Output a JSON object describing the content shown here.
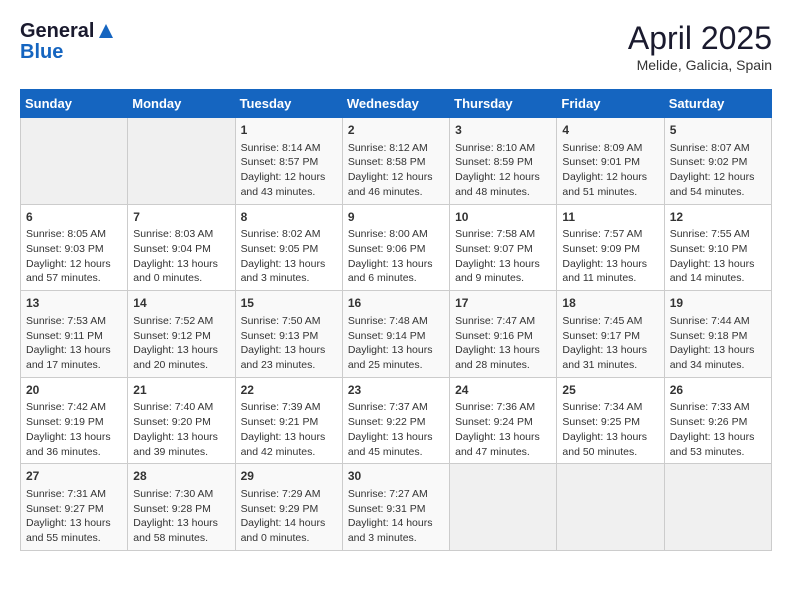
{
  "header": {
    "logo_general": "General",
    "logo_blue": "Blue",
    "title": "April 2025",
    "location": "Melide, Galicia, Spain"
  },
  "days_of_week": [
    "Sunday",
    "Monday",
    "Tuesday",
    "Wednesday",
    "Thursday",
    "Friday",
    "Saturday"
  ],
  "weeks": [
    [
      {
        "day": "",
        "content": ""
      },
      {
        "day": "",
        "content": ""
      },
      {
        "day": "1",
        "content": "Sunrise: 8:14 AM\nSunset: 8:57 PM\nDaylight: 12 hours and 43 minutes."
      },
      {
        "day": "2",
        "content": "Sunrise: 8:12 AM\nSunset: 8:58 PM\nDaylight: 12 hours and 46 minutes."
      },
      {
        "day": "3",
        "content": "Sunrise: 8:10 AM\nSunset: 8:59 PM\nDaylight: 12 hours and 48 minutes."
      },
      {
        "day": "4",
        "content": "Sunrise: 8:09 AM\nSunset: 9:01 PM\nDaylight: 12 hours and 51 minutes."
      },
      {
        "day": "5",
        "content": "Sunrise: 8:07 AM\nSunset: 9:02 PM\nDaylight: 12 hours and 54 minutes."
      }
    ],
    [
      {
        "day": "6",
        "content": "Sunrise: 8:05 AM\nSunset: 9:03 PM\nDaylight: 12 hours and 57 minutes."
      },
      {
        "day": "7",
        "content": "Sunrise: 8:03 AM\nSunset: 9:04 PM\nDaylight: 13 hours and 0 minutes."
      },
      {
        "day": "8",
        "content": "Sunrise: 8:02 AM\nSunset: 9:05 PM\nDaylight: 13 hours and 3 minutes."
      },
      {
        "day": "9",
        "content": "Sunrise: 8:00 AM\nSunset: 9:06 PM\nDaylight: 13 hours and 6 minutes."
      },
      {
        "day": "10",
        "content": "Sunrise: 7:58 AM\nSunset: 9:07 PM\nDaylight: 13 hours and 9 minutes."
      },
      {
        "day": "11",
        "content": "Sunrise: 7:57 AM\nSunset: 9:09 PM\nDaylight: 13 hours and 11 minutes."
      },
      {
        "day": "12",
        "content": "Sunrise: 7:55 AM\nSunset: 9:10 PM\nDaylight: 13 hours and 14 minutes."
      }
    ],
    [
      {
        "day": "13",
        "content": "Sunrise: 7:53 AM\nSunset: 9:11 PM\nDaylight: 13 hours and 17 minutes."
      },
      {
        "day": "14",
        "content": "Sunrise: 7:52 AM\nSunset: 9:12 PM\nDaylight: 13 hours and 20 minutes."
      },
      {
        "day": "15",
        "content": "Sunrise: 7:50 AM\nSunset: 9:13 PM\nDaylight: 13 hours and 23 minutes."
      },
      {
        "day": "16",
        "content": "Sunrise: 7:48 AM\nSunset: 9:14 PM\nDaylight: 13 hours and 25 minutes."
      },
      {
        "day": "17",
        "content": "Sunrise: 7:47 AM\nSunset: 9:16 PM\nDaylight: 13 hours and 28 minutes."
      },
      {
        "day": "18",
        "content": "Sunrise: 7:45 AM\nSunset: 9:17 PM\nDaylight: 13 hours and 31 minutes."
      },
      {
        "day": "19",
        "content": "Sunrise: 7:44 AM\nSunset: 9:18 PM\nDaylight: 13 hours and 34 minutes."
      }
    ],
    [
      {
        "day": "20",
        "content": "Sunrise: 7:42 AM\nSunset: 9:19 PM\nDaylight: 13 hours and 36 minutes."
      },
      {
        "day": "21",
        "content": "Sunrise: 7:40 AM\nSunset: 9:20 PM\nDaylight: 13 hours and 39 minutes."
      },
      {
        "day": "22",
        "content": "Sunrise: 7:39 AM\nSunset: 9:21 PM\nDaylight: 13 hours and 42 minutes."
      },
      {
        "day": "23",
        "content": "Sunrise: 7:37 AM\nSunset: 9:22 PM\nDaylight: 13 hours and 45 minutes."
      },
      {
        "day": "24",
        "content": "Sunrise: 7:36 AM\nSunset: 9:24 PM\nDaylight: 13 hours and 47 minutes."
      },
      {
        "day": "25",
        "content": "Sunrise: 7:34 AM\nSunset: 9:25 PM\nDaylight: 13 hours and 50 minutes."
      },
      {
        "day": "26",
        "content": "Sunrise: 7:33 AM\nSunset: 9:26 PM\nDaylight: 13 hours and 53 minutes."
      }
    ],
    [
      {
        "day": "27",
        "content": "Sunrise: 7:31 AM\nSunset: 9:27 PM\nDaylight: 13 hours and 55 minutes."
      },
      {
        "day": "28",
        "content": "Sunrise: 7:30 AM\nSunset: 9:28 PM\nDaylight: 13 hours and 58 minutes."
      },
      {
        "day": "29",
        "content": "Sunrise: 7:29 AM\nSunset: 9:29 PM\nDaylight: 14 hours and 0 minutes."
      },
      {
        "day": "30",
        "content": "Sunrise: 7:27 AM\nSunset: 9:31 PM\nDaylight: 14 hours and 3 minutes."
      },
      {
        "day": "",
        "content": ""
      },
      {
        "day": "",
        "content": ""
      },
      {
        "day": "",
        "content": ""
      }
    ]
  ]
}
